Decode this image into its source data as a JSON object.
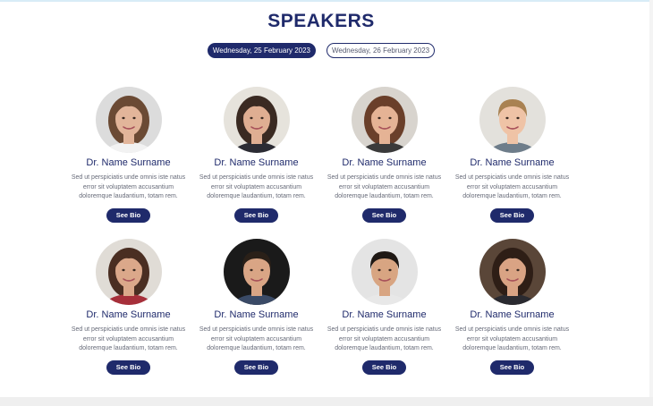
{
  "page": {
    "title": "SPEAKERS"
  },
  "date_tabs": [
    {
      "label": "Wednesday, 25 February 2023",
      "active": true
    },
    {
      "label": "Wednesday, 26 February 2023",
      "active": false
    }
  ],
  "speakers": [
    {
      "name": "Dr. Name Surname",
      "bio": "Sed ut perspiciatis unde omnis iste natus error sit voluptatem accusantium doloremque laudantium, totam rem.",
      "button": "See Bio",
      "photo": {
        "bg": "#dcdcdc",
        "skin": "#e2b59a",
        "hair": "#6b4a34",
        "shirt": "#f2f2f2",
        "hair_style": "long"
      }
    },
    {
      "name": "Dr. Name Surname",
      "bio": "Sed ut perspiciatis unde omnis iste natus error sit voluptatem accusantium doloremque laudantium, totam rem.",
      "button": "See Bio",
      "photo": {
        "bg": "#e6e3dc",
        "skin": "#dfae92",
        "hair": "#3a2a22",
        "shirt": "#2b2b33",
        "hair_style": "long"
      }
    },
    {
      "name": "Dr. Name Surname",
      "bio": "Sed ut perspiciatis unde omnis iste natus error sit voluptatem accusantium doloremque laudantium, totam rem.",
      "button": "See Bio",
      "photo": {
        "bg": "#d8d4ce",
        "skin": "#e5b395",
        "hair": "#6a3f2a",
        "shirt": "#3a3a3a",
        "hair_style": "long"
      }
    },
    {
      "name": "Dr. Name Surname",
      "bio": "Sed ut perspiciatis unde omnis iste natus error sit voluptatem accusantium doloremque laudantium, totam rem.",
      "button": "See Bio",
      "photo": {
        "bg": "#e3e1dc",
        "skin": "#efc3a6",
        "hair": "#a98252",
        "shirt": "#6e7d8a",
        "hair_style": "short"
      }
    },
    {
      "name": "Dr. Name Surname",
      "bio": "Sed ut perspiciatis unde omnis iste natus error sit voluptatem accusantium doloremque laudantium, totam rem.",
      "button": "See Bio",
      "photo": {
        "bg": "#e0dcd6",
        "skin": "#dba88a",
        "hair": "#4a2e22",
        "shirt": "#a62f3a",
        "hair_style": "long"
      }
    },
    {
      "name": "Dr. Name Surname",
      "bio": "Sed ut perspiciatis unde omnis iste natus error sit voluptatem accusantium doloremque laudantium, totam rem.",
      "button": "See Bio",
      "photo": {
        "bg": "#1a1a1a",
        "skin": "#d9a585",
        "hair": "#2a2018",
        "shirt": "#3a4a66",
        "hair_style": "short"
      }
    },
    {
      "name": "Dr. Name Surname",
      "bio": "Sed ut perspiciatis unde omnis iste natus error sit voluptatem accusantium doloremque laudantium, totam rem.",
      "button": "See Bio",
      "photo": {
        "bg": "#e4e4e4",
        "skin": "#d8a582",
        "hair": "#1e1814",
        "shirt": "#e8e8e8",
        "hair_style": "short"
      }
    },
    {
      "name": "Dr. Name Surname",
      "bio": "Sed ut perspiciatis unde omnis iste natus error sit voluptatem accusantium doloremque laudantium, totam rem.",
      "button": "See Bio",
      "photo": {
        "bg": "#5a4638",
        "skin": "#d9a384",
        "hair": "#2e1e16",
        "shirt": "#2a2a30",
        "hair_style": "long"
      }
    }
  ]
}
